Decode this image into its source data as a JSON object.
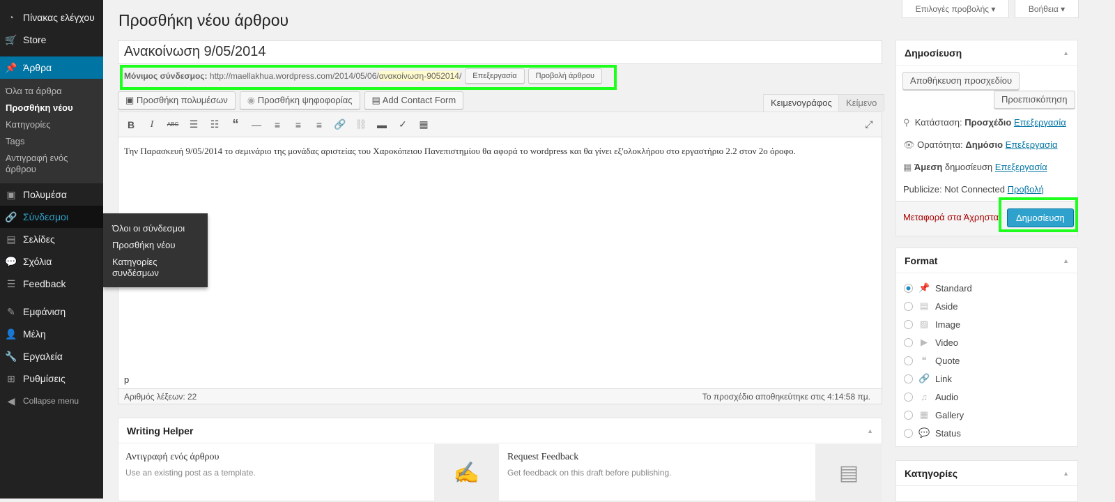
{
  "sidebar": {
    "items": [
      {
        "label": "Πίνακας ελέγχου",
        "icon": "dashboard-icon"
      },
      {
        "label": "Store",
        "icon": "cart-icon"
      },
      {
        "label": "Άρθρα",
        "icon": "pin-icon"
      },
      {
        "label": "Πολυμέσα",
        "icon": "media-icon"
      },
      {
        "label": "Σύνδεσμοι",
        "icon": "link-icon"
      },
      {
        "label": "Σελίδες",
        "icon": "pages-icon"
      },
      {
        "label": "Σχόλια",
        "icon": "comment-icon"
      },
      {
        "label": "Feedback",
        "icon": "feedback-icon"
      },
      {
        "label": "Εμφάνιση",
        "icon": "brush-icon"
      },
      {
        "label": "Μέλη",
        "icon": "user-icon"
      },
      {
        "label": "Εργαλεία",
        "icon": "wrench-icon"
      },
      {
        "label": "Ρυθμίσεις",
        "icon": "settings-icon"
      },
      {
        "label": "Collapse menu",
        "icon": "collapse-icon"
      }
    ],
    "posts_sub": [
      "Όλα τα άρθρα",
      "Προσθήκη νέου",
      "Κατηγορίες",
      "Tags",
      "Αντιγραφή ενός άρθρου"
    ],
    "links_flyout": [
      "Όλοι οι σύνδεσμοι",
      "Προσθήκη νέου",
      "Κατηγορίες συνδέσμων"
    ]
  },
  "top": {
    "screen_options": "Επιλογές προβολής",
    "help": "Βοήθεια"
  },
  "page_title": "Προσθήκη νέου άρθρου",
  "post_title": "Ανακοίνωση 9/05/2014",
  "permalink": {
    "label": "Μόνιμος σύνδεσμος:",
    "base": "http://maellakhua.wordpress.com/2014/05/06/",
    "slug": "ανακοίνωση-9052014",
    "trail": "/",
    "edit": "Επεξεργασία",
    "view": "Προβολή άρθρου"
  },
  "media_buttons": [
    "Προσθήκη πολυμέσων",
    "Προσθήκη ψηφοφορίας",
    "Add Contact Form"
  ],
  "editor_tabs": {
    "visual": "Κειμενογράφος",
    "text": "Κείμενο"
  },
  "toolbar": {
    "bold": "B",
    "italic": "I",
    "strike": "ABC"
  },
  "content": "Την Παρασκευή 9/05/2014 το σεμινάριο της μονάδας αριστείας του Χαροκόπειου Πανεπιστημίου θα αφορά το wordpress και θα γίνει εξ'ολοκλήρου στο εργαστήριο 2.2 στον 2ο όροφο.",
  "path": "p",
  "word_count": "Αριθμός λέξεων: 22",
  "autosave": "Το προσχέδιο αποθηκεύτηκε στις 4:14:58 πμ.",
  "writing_helper": {
    "title": "Writing Helper",
    "copy_title": "Αντιγραφή ενός άρθρου",
    "copy_desc": "Use an existing post as a template.",
    "fb_title": "Request Feedback",
    "fb_desc": "Get feedback on this draft before publishing."
  },
  "publish": {
    "title": "Δημοσίευση",
    "save_draft": "Αποθήκευση προσχεδίου",
    "preview": "Προεπισκόπηση",
    "status_label": "Κατάσταση:",
    "status": "Προσχέδιο",
    "visibility_label": "Ορατότητα:",
    "visibility": "Δημόσιο",
    "schedule_bold": "Άμεση",
    "schedule": "δημοσίευση",
    "edit": "Επεξεργασία",
    "publicize": "Publicize: Not Connected",
    "publicize_link": "Προβολή",
    "trash": "Μεταφορά στα Άχρηστα",
    "publish_btn": "Δημοσίευση"
  },
  "format": {
    "title": "Format",
    "options": [
      "Standard",
      "Aside",
      "Image",
      "Video",
      "Quote",
      "Link",
      "Audio",
      "Gallery",
      "Status"
    ],
    "selected": "Standard"
  },
  "categories": {
    "title": "Κατηγορίες"
  },
  "colors": {
    "accent": "#0074a2",
    "highlight": "#1eff1e",
    "publish": "#2ea2cc"
  }
}
